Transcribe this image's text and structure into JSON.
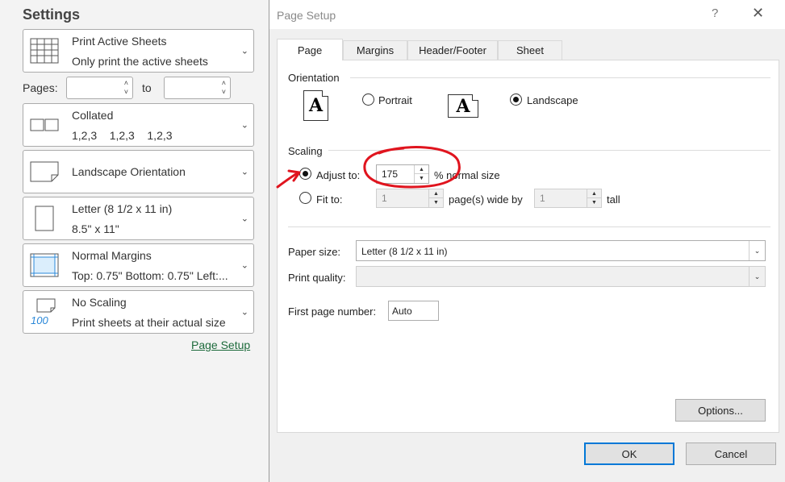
{
  "settings": {
    "title": "Settings",
    "print_what": {
      "line1": "Print Active Sheets",
      "line2": "Only print the active sheets"
    },
    "pages": {
      "label": "Pages:",
      "to": "to",
      "from_value": "",
      "to_value": ""
    },
    "collation": {
      "line1": "Collated",
      "line2": "1,2,3    1,2,3    1,2,3"
    },
    "orientation": {
      "label": "Landscape Orientation"
    },
    "paper": {
      "line1": "Letter (8 1/2 x 11 in)",
      "line2": "8.5\" x 11\""
    },
    "margins": {
      "line1": "Normal Margins",
      "line2": "Top: 0.75\" Bottom: 0.75\" Left:..."
    },
    "scaling": {
      "line1": "No Scaling",
      "line2": "Print sheets at their actual size",
      "icon_text": "100"
    },
    "page_setup_link": "Page Setup"
  },
  "dialog": {
    "title": "Page Setup",
    "help": "?",
    "close": "✕",
    "tabs": [
      {
        "label": "Page",
        "active": true
      },
      {
        "label": "Margins",
        "active": false
      },
      {
        "label": "Header/Footer",
        "active": false
      },
      {
        "label": "Sheet",
        "active": false
      }
    ],
    "orientation": {
      "label": "Orientation",
      "icon_letter": "A",
      "portrait_label": "Portrait",
      "landscape_label": "Landscape",
      "selected": "landscape"
    },
    "scaling": {
      "label": "Scaling",
      "adjust_label": "Adjust to:",
      "adjust_value": "175",
      "adjust_suffix": "% normal size",
      "fit_label": "Fit to:",
      "fit_wide_value": "1",
      "fit_wide_suffix": "page(s) wide by",
      "fit_tall_value": "1",
      "fit_tall_suffix": "tall",
      "selected": "adjust"
    },
    "paper_size": {
      "label": "Paper size:",
      "value": "Letter (8 1/2 x 11 in)"
    },
    "print_quality": {
      "label": "Print quality:",
      "value": ""
    },
    "first_page_number": {
      "label": "First page number:",
      "value": "Auto"
    },
    "options_label": "Options...",
    "ok_label": "OK",
    "cancel_label": "Cancel"
  },
  "colors": {
    "annotation": "#e0141e",
    "link": "#1e6b3c",
    "default_button_border": "#0078d7"
  }
}
